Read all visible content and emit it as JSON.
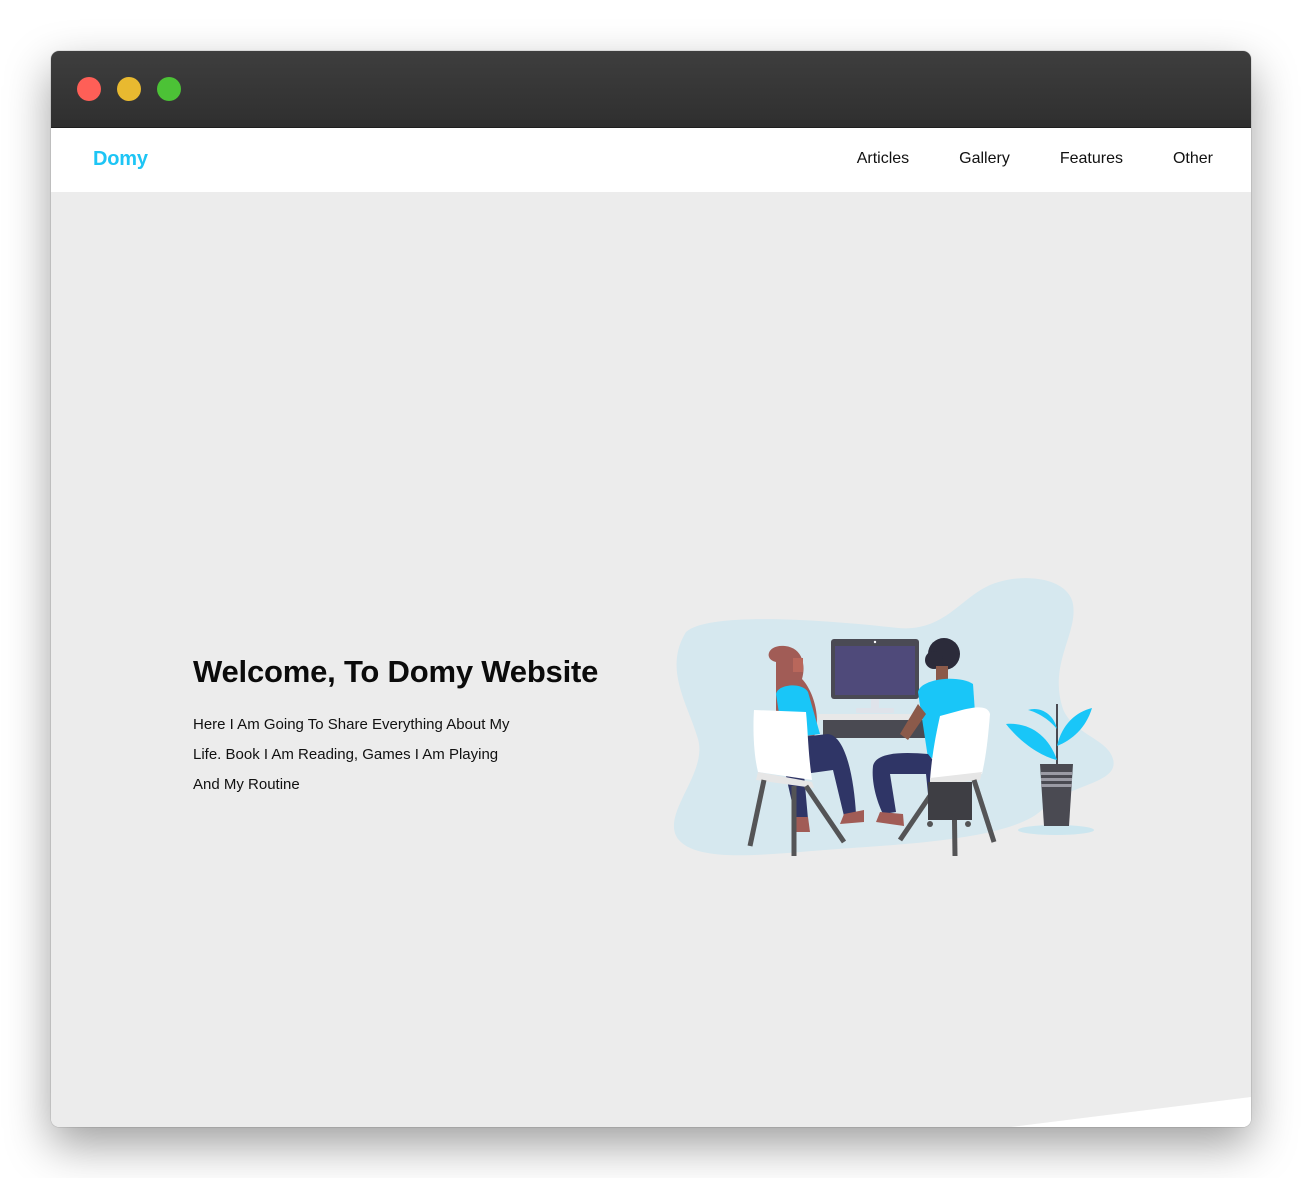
{
  "window": {
    "controls": [
      "close",
      "minimize",
      "zoom"
    ],
    "colors": {
      "close": "#fe5f57",
      "minimize": "#e8b930",
      "zoom": "#4cc236",
      "titlebar": "#353535",
      "page_bg": "#ececec"
    }
  },
  "nav": {
    "brand": "Domy",
    "brand_color": "#1ec5f5",
    "links": [
      "Articles",
      "Gallery",
      "Features",
      "Other"
    ]
  },
  "hero": {
    "title": "Welcome, To Domy Website",
    "description": "Here I Am Going To Share Everything About My Life. Book I Am Reading, Games I Am Playing And My Routine",
    "illustration": {
      "description_icon": "two-people-at-computer-illustration",
      "accent_color": "#19c6f8",
      "blob_color": "#d6e8ef"
    }
  }
}
